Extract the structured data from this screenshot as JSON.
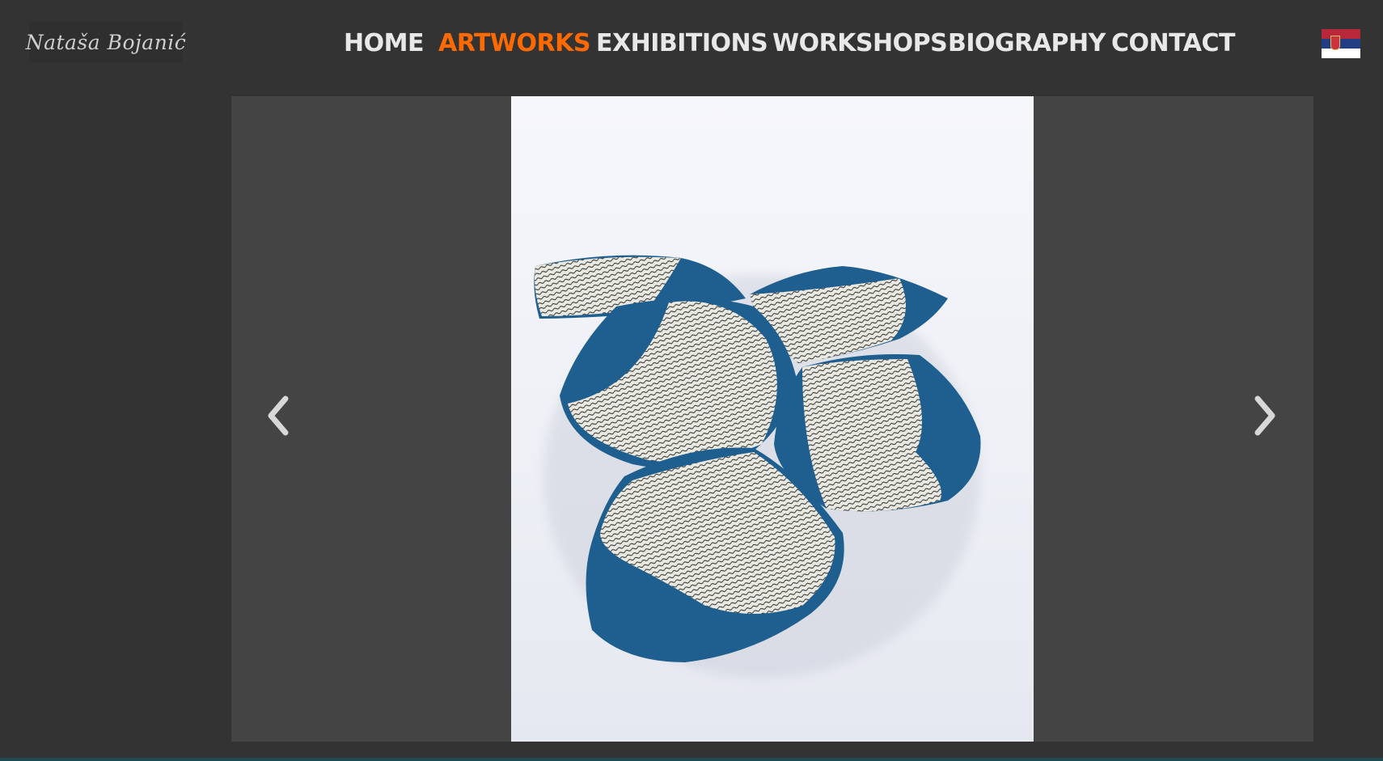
{
  "site": {
    "logo_text": "Nataša Bojanić"
  },
  "nav": {
    "items": [
      {
        "label": "HOME",
        "active": false
      },
      {
        "label": "ARTWORKS",
        "active": true
      },
      {
        "label": "EXHIBITIONS",
        "active": false
      },
      {
        "label": "WORKSHOPS",
        "active": false
      },
      {
        "label": "BIOGRAPHY",
        "active": false
      },
      {
        "label": "CONTACT",
        "active": false
      }
    ]
  },
  "language_flag": {
    "icon": "serbia-flag-icon"
  },
  "gallery": {
    "prev_icon": "chevron-left-icon",
    "next_icon": "chevron-right-icon",
    "image": "ceramic plates artwork photo"
  },
  "colors": {
    "background": "#333333",
    "stage": "#444444",
    "nav_text": "#e8e8e8",
    "nav_active": "#ff6a00",
    "ceramic_blue": "#1f5f8f"
  }
}
